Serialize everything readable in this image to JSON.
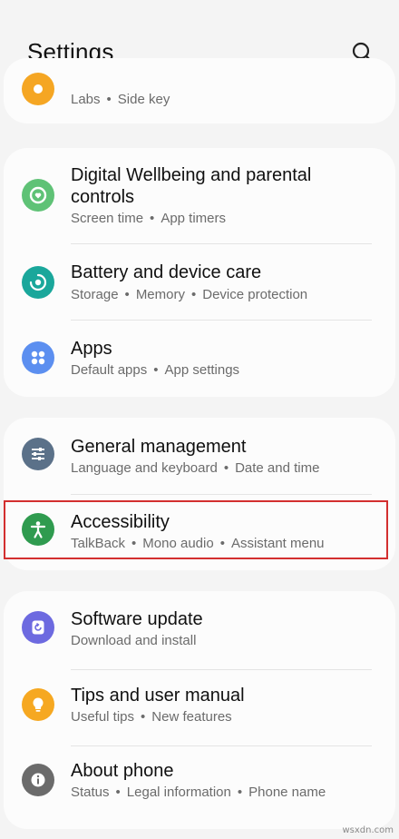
{
  "header": {
    "title": "Settings",
    "search_icon": "search-icon"
  },
  "colors": {
    "labs_icon": "#f5a623",
    "wellbeing_icon": "#5fc276",
    "battery_icon": "#1aa79b",
    "apps_icon": "#5c8ff0",
    "general_icon": "#5b7189",
    "accessibility_icon": "#2f9b4f",
    "software_icon": "#6d6ae0",
    "tips_icon": "#f6a821",
    "about_icon": "#6b6b6b",
    "highlight": "#d32f2f"
  },
  "items": {
    "labs": {
      "subs": [
        "Labs",
        "Side key"
      ]
    },
    "wellbeing": {
      "label_line1": "Digital Wellbeing and parental",
      "label_line2": "controls",
      "subs": [
        "Screen time",
        "App timers"
      ]
    },
    "battery": {
      "label": "Battery and device care",
      "subs": [
        "Storage",
        "Memory",
        "Device protection"
      ]
    },
    "apps": {
      "label": "Apps",
      "subs": [
        "Default apps",
        "App settings"
      ]
    },
    "general": {
      "label": "General management",
      "subs": [
        "Language and keyboard",
        "Date and time"
      ]
    },
    "accessibility": {
      "label": "Accessibility",
      "subs": [
        "TalkBack",
        "Mono audio",
        "Assistant menu"
      ]
    },
    "software": {
      "label": "Software update",
      "subs": [
        "Download and install"
      ]
    },
    "tips": {
      "label": "Tips and user manual",
      "subs": [
        "Useful tips",
        "New features"
      ]
    },
    "about": {
      "label": "About phone",
      "subs": [
        "Status",
        "Legal information",
        "Phone name"
      ]
    }
  },
  "separator": "•",
  "watermark": "wsxdn.com"
}
